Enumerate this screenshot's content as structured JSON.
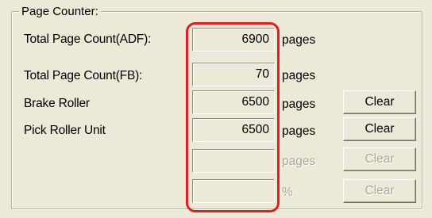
{
  "group": {
    "title": "Page Counter:"
  },
  "rows": [
    {
      "label": "Total Page Count(ADF):",
      "value": "6900",
      "unit": "pages"
    },
    {
      "label": "Total Page Count(FB):",
      "value": "70",
      "unit": "pages"
    },
    {
      "label": "Brake Roller",
      "value": "6500",
      "unit": "pages",
      "button": "Clear"
    },
    {
      "label": "Pick Roller Unit",
      "value": "6500",
      "unit": "pages",
      "button": "Clear"
    },
    {
      "label": "",
      "value": "",
      "unit": "pages",
      "button": "Clear",
      "disabled": true
    },
    {
      "label": "",
      "value": "",
      "unit": "%",
      "button": "Clear",
      "disabled": true
    }
  ],
  "colors": {
    "highlight": "#e01e1e",
    "disabled_text": "#aca899",
    "panel": "#ece9d8"
  }
}
